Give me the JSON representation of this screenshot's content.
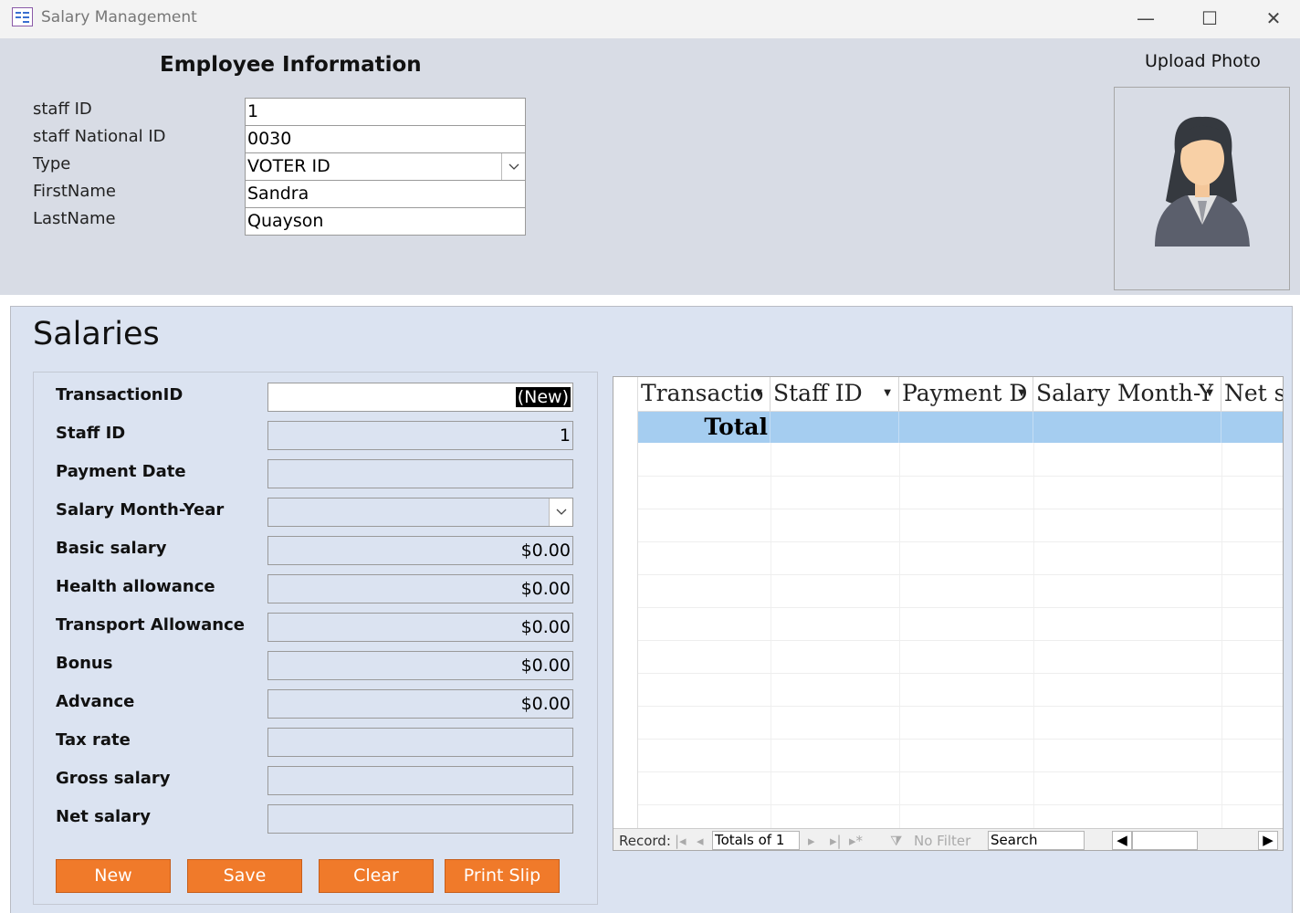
{
  "window": {
    "title": "Salary Management",
    "minimize": "—",
    "maximize": "☐",
    "close": "✕"
  },
  "employee": {
    "title": "Employee Information",
    "fields": [
      {
        "label": "staff ID",
        "value": "1"
      },
      {
        "label": "staff National ID",
        "value": "0030"
      },
      {
        "label": "Type",
        "value": "VOTER ID"
      },
      {
        "label": "FirstName",
        "value": "Sandra"
      },
      {
        "label": "LastName",
        "value": "Quayson"
      }
    ],
    "upload_label": "Upload Photo"
  },
  "salaries": {
    "title": "Salaries",
    "fields": [
      {
        "label": "TransactionID",
        "value": "(New)"
      },
      {
        "label": "Staff ID",
        "value": "1"
      },
      {
        "label": "Payment Date",
        "value": ""
      },
      {
        "label": "Salary Month-Year",
        "value": ""
      },
      {
        "label": "Basic salary",
        "value": "$0.00"
      },
      {
        "label": "Health allowance",
        "value": "$0.00"
      },
      {
        "label": "Transport Allowance",
        "value": "$0.00"
      },
      {
        "label": "Bonus",
        "value": "$0.00"
      },
      {
        "label": "Advance",
        "value": "$0.00"
      },
      {
        "label": "Tax rate",
        "value": ""
      },
      {
        "label": "Gross salary",
        "value": ""
      },
      {
        "label": "Net salary",
        "value": ""
      }
    ],
    "buttons": {
      "new": "New",
      "save": "Save",
      "clear": "Clear",
      "print": "Print Slip"
    }
  },
  "grid": {
    "columns": [
      "Transactio",
      "Staff ID",
      "Payment D",
      "Salary Month-Y",
      "Net s"
    ],
    "total_label": "Total",
    "nav": {
      "record_label": "Record:",
      "position": "Totals of 1",
      "filter": "No Filter",
      "search": "Search"
    }
  }
}
